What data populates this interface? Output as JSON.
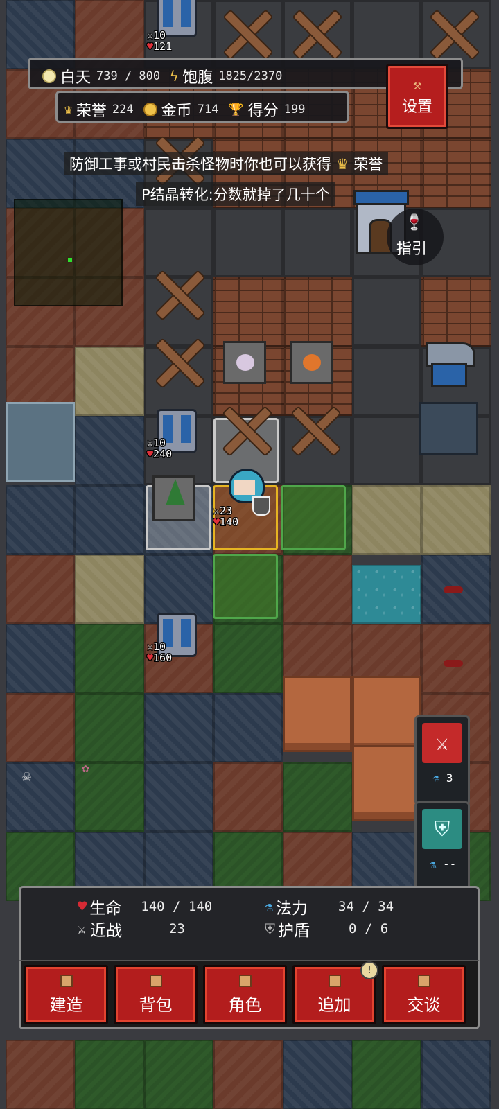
{
  "hud": {
    "day_label": "白天",
    "day_value": "739 / 800",
    "satiety_label": "饱腹",
    "satiety_value": "1825/2370",
    "honor_label": "荣誉",
    "honor_value": "224",
    "gold_label": "金币",
    "gold_value": "714",
    "score_label": "得分",
    "score_value": "199"
  },
  "settings_label": "设置",
  "tips": {
    "line1_prefix": "防御工事或村民击杀怪物时你也可以获得",
    "line1_suffix": "荣誉",
    "line2": "P结晶转化:分数就掉了几十个"
  },
  "guide_label": "指引",
  "units": [
    {
      "atk": "10",
      "hp": "121"
    },
    {
      "atk": "10",
      "hp": "240"
    },
    {
      "atk": "10",
      "hp": "160"
    }
  ],
  "player": {
    "atk": "23",
    "hp": "140"
  },
  "skills": [
    {
      "icon": "sword-skill-icon",
      "mana": "3",
      "color": "#c42a2a"
    },
    {
      "icon": "shield-skill-icon",
      "mana": "--",
      "color": "#2c8c82"
    }
  ],
  "stats": {
    "hp_label": "生命",
    "hp_value": "140 / 140",
    "mana_label": "法力",
    "mana_value": "34  /  34",
    "melee_label": "近战",
    "melee_value": "23",
    "shield_label": "护盾",
    "shield_value": "0  /  6"
  },
  "actions": [
    {
      "label": "建造"
    },
    {
      "label": "背包"
    },
    {
      "label": "角色"
    },
    {
      "label": "追加",
      "badge": "!"
    },
    {
      "label": "交谈"
    }
  ],
  "colors": {
    "button_red": "#b31d1d",
    "gold": "#f0c24a",
    "heart": "#e0303a",
    "highlight_gold": "#e6b422"
  }
}
